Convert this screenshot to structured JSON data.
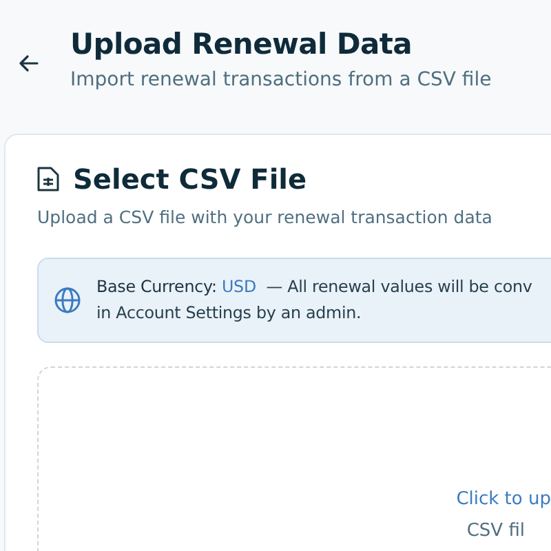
{
  "header": {
    "title": "Upload Renewal Data",
    "subtitle": "Import renewal transactions from a CSV file"
  },
  "card": {
    "title": "Select CSV File",
    "subtitle": "Upload a CSV file with your renewal transaction data",
    "info": {
      "label": "Base Currency:",
      "currency": "USD",
      "line1": "— All renewal values will be conv",
      "line2": "in Account Settings by an admin."
    },
    "dropzone": {
      "link": "Click to up",
      "hint": "CSV fil"
    }
  }
}
